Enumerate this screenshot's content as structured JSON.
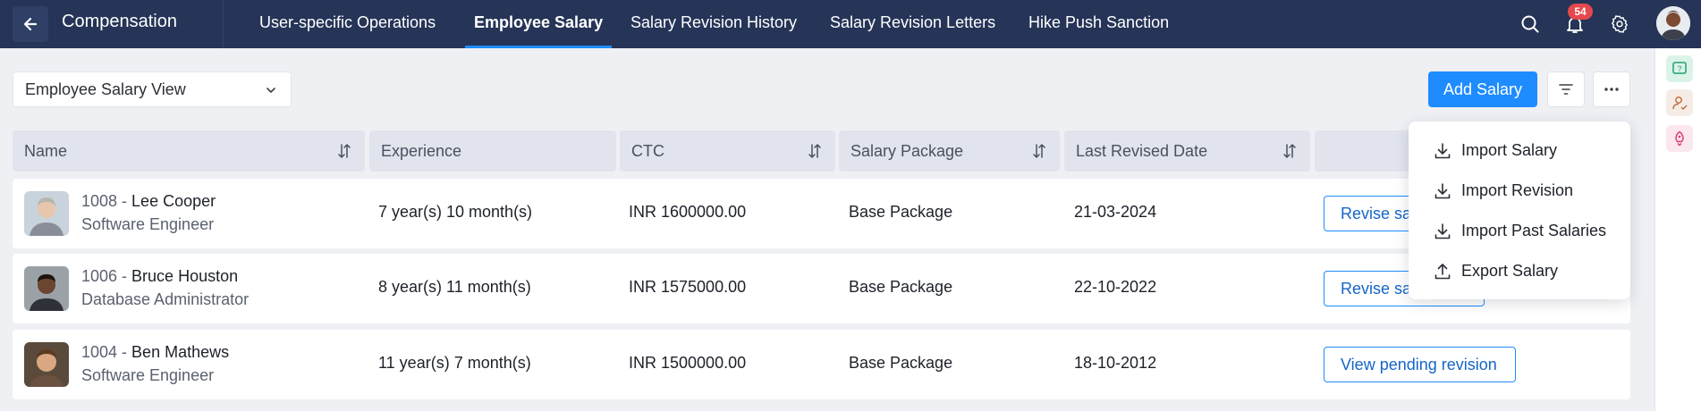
{
  "app": {
    "title": "Compensation"
  },
  "nav": {
    "tabs": [
      {
        "label": "User-specific Operations",
        "active": false
      },
      {
        "label": "Employee Salary",
        "active": true
      },
      {
        "label": "Salary Revision History",
        "active": false
      },
      {
        "label": "Salary Revision Letters",
        "active": false
      },
      {
        "label": "Hike Push Sanction",
        "active": false
      }
    ],
    "notification_count": "54",
    "icons": [
      "search-icon",
      "bell-icon",
      "gear-icon"
    ]
  },
  "toolbar": {
    "view_select": "Employee Salary View",
    "add_button": "Add Salary"
  },
  "table": {
    "columns": [
      "Name",
      "Experience",
      "CTC",
      "Salary Package",
      "Last Revised Date"
    ],
    "rows": [
      {
        "id": "1008",
        "name": "Lee Cooper",
        "role": "Software Engineer",
        "experience": "7 year(s) 10 month(s)",
        "ctc": "INR 1600000.00",
        "package": "Base Package",
        "revised": "21-03-2024",
        "action": "Revise salary"
      },
      {
        "id": "1006",
        "name": "Bruce Houston",
        "role": "Database Administrator",
        "experience": "8 year(s) 11 month(s)",
        "ctc": "INR 1575000.00",
        "package": "Base Package",
        "revised": "22-10-2022",
        "action": "Revise salary"
      },
      {
        "id": "1004",
        "name": "Ben Mathews",
        "role": "Software Engineer",
        "experience": "11 year(s) 7 month(s)",
        "ctc": "INR 1500000.00",
        "package": "Base Package",
        "revised": "18-10-2012",
        "action": "View pending revision"
      }
    ]
  },
  "menu": {
    "items": [
      {
        "label": "Import Salary",
        "icon": "download-icon"
      },
      {
        "label": "Import Revision",
        "icon": "download-icon"
      },
      {
        "label": "Import Past Salaries",
        "icon": "download-icon"
      },
      {
        "label": "Export Salary",
        "icon": "upload-icon"
      }
    ]
  },
  "colors": {
    "topbar": "#253457",
    "accent": "#1e8cff",
    "badge": "#e5484d"
  }
}
